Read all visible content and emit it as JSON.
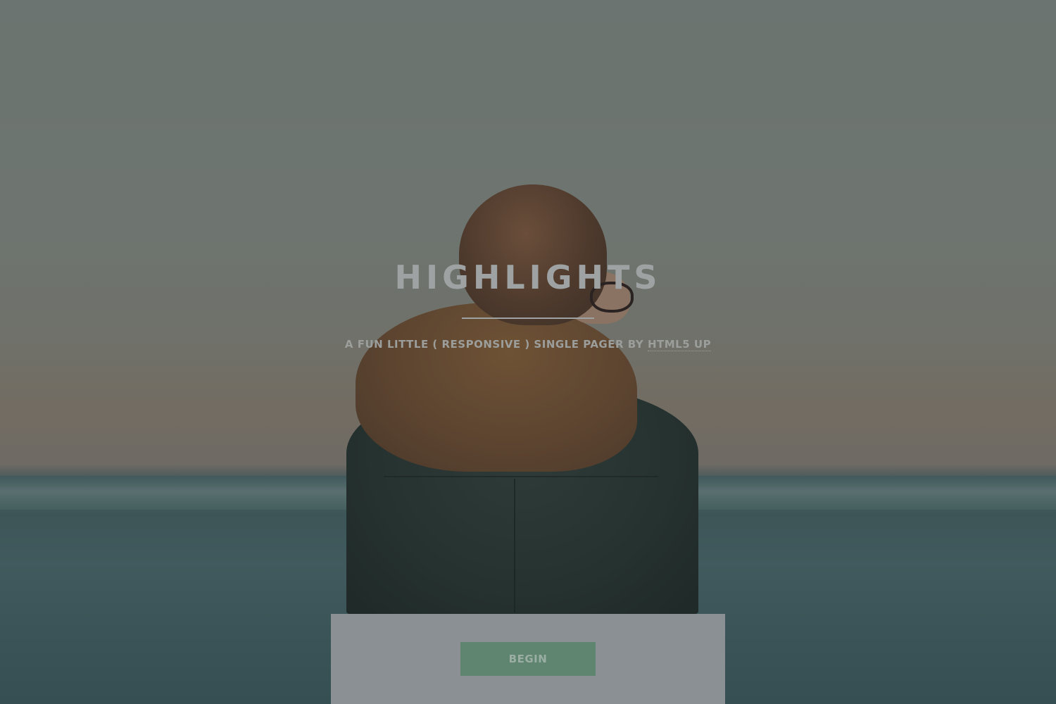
{
  "header": {
    "title": "HIGHLIGHTS",
    "tagline_prefix": "A FUN LITTLE ( RESPONSIVE ) SINGLE PAGER BY ",
    "tagline_link": "HTML5 UP"
  },
  "actions": {
    "begin_label": "BEGIN"
  },
  "colors": {
    "button": "#5f8570",
    "panel": "#8b9094",
    "title_text": "#9fa2a2"
  }
}
